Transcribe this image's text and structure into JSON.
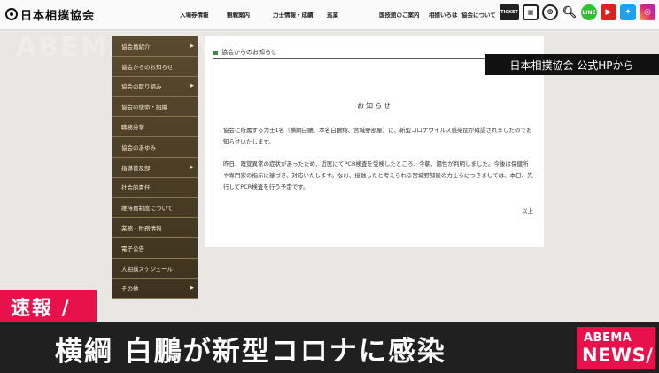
{
  "header": {
    "logo": "日本相撲協会",
    "nav": [
      "入場券情報",
      "観戦案内",
      "力士情報・成績",
      "巡業",
      "国技館のご案内",
      "相撲いろは",
      "協会について"
    ],
    "icons": [
      "ticket-icon",
      "calendar-icon",
      "globe-icon",
      "search-icon",
      "line-icon",
      "youtube-icon",
      "twitter-icon",
      "instagram-icon"
    ],
    "ticket_label": "TICKET",
    "line_label": "LINE"
  },
  "sidebar": {
    "items": [
      {
        "label": "協会員紹介",
        "arrow": true
      },
      {
        "label": "協会からのお知らせ",
        "arrow": false
      },
      {
        "label": "協会の取り組み",
        "arrow": true
      },
      {
        "label": "協会の使命・組織",
        "arrow": false
      },
      {
        "label": "職務分掌",
        "arrow": false
      },
      {
        "label": "協会のあゆみ",
        "arrow": false
      },
      {
        "label": "指導普及部",
        "arrow": true
      },
      {
        "label": "社会的責任",
        "arrow": false
      },
      {
        "label": "維持員制度について",
        "arrow": false
      },
      {
        "label": "業務・財務情報",
        "arrow": false
      },
      {
        "label": "電子公告",
        "arrow": false
      },
      {
        "label": "大相撲スケジュール",
        "arrow": false
      },
      {
        "label": "その他",
        "arrow": true
      }
    ]
  },
  "content": {
    "section_title": "協会からのお知らせ",
    "notice_title": "お知らせ",
    "paragraph1": "協会に所属する力士1名（横綱白鵬、本名白鵬翔、宮城野部屋）に、新型コロナウイルス感染症が確認されましたのでお知らせいたします。",
    "paragraph2": "昨日、嗅覚異常の症状があったため、近医にてPCR検査を受検したところ、今朝、陽性が判明しました。今後は保健所や専門家の指示に基づき、対応いたします。なお、接触したと考えられる宮城野部屋の力士らにつきましては、本日、先行してPCR検査を行う予定です。",
    "closing": "以上"
  },
  "overlay": {
    "source": "日本相撲協会 公式HPから",
    "watermark": "ABEMA NEWS",
    "breaking": "速報 /",
    "headline": "横綱 白鵬が新型コロナに感染",
    "brand_line1": "ABEMA",
    "brand_line2": "NEWS/"
  }
}
